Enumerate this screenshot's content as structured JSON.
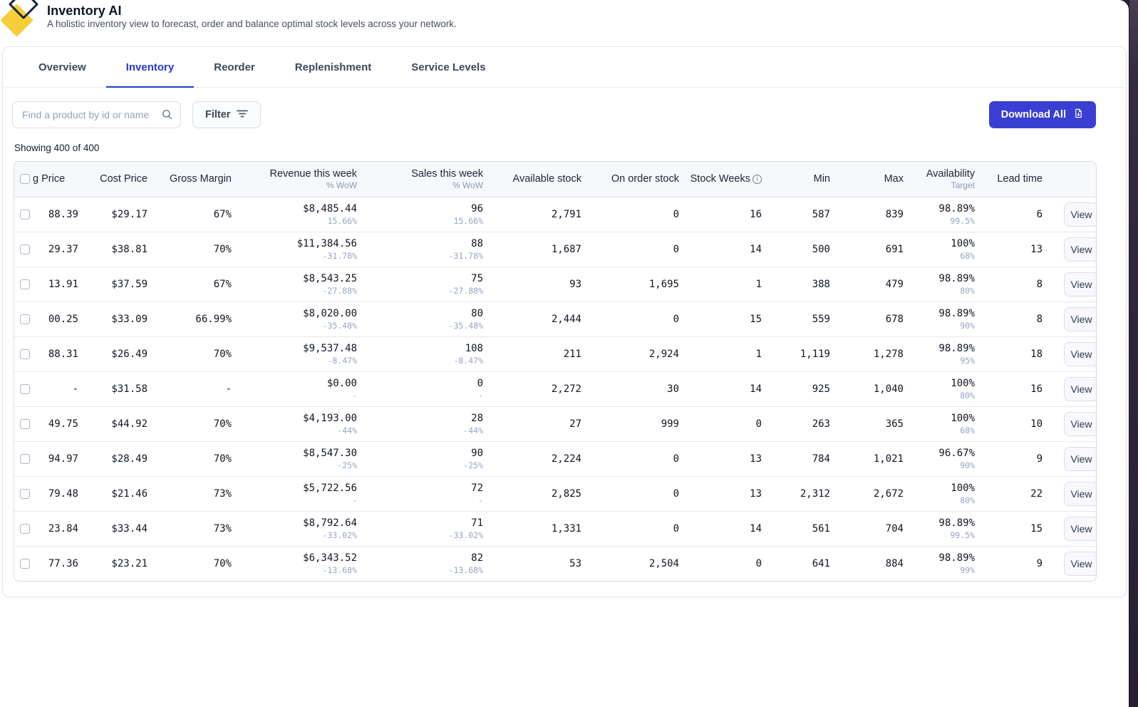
{
  "header": {
    "app_title": "Inventory AI",
    "subtitle": "A holistic inventory view to forecast, order and balance optimal stock levels across your network."
  },
  "tabs": [
    {
      "label": "Overview",
      "active": false
    },
    {
      "label": "Inventory",
      "active": true
    },
    {
      "label": "Reorder",
      "active": false
    },
    {
      "label": "Replenishment",
      "active": false
    },
    {
      "label": "Service Levels",
      "active": false
    }
  ],
  "toolbar": {
    "search_placeholder": "Find a product by id or name",
    "filter_label": "Filter",
    "download_label": "Download All"
  },
  "results_summary": "Showing 400 of 400",
  "colors": {
    "accent_blue": "#2438cf",
    "download_button_blue": "#3a3fd3",
    "brand_yellow": "#f6ce3b",
    "brand_navy": "#1b2438",
    "muted_value_text": "#97a4c2"
  },
  "table": {
    "view_label": "View",
    "columns": [
      {
        "key": "selling_price",
        "label": "g Price"
      },
      {
        "key": "cost_price",
        "label": "Cost Price"
      },
      {
        "key": "gross_margin",
        "label": "Gross Margin"
      },
      {
        "key": "revenue",
        "label": "Revenue this week",
        "sub": "% WoW"
      },
      {
        "key": "sales",
        "label": "Sales this week",
        "sub": "% WoW"
      },
      {
        "key": "available",
        "label": "Available stock"
      },
      {
        "key": "on_order",
        "label": "On order stock"
      },
      {
        "key": "stock_weeks",
        "label": "Stock Weeks",
        "info": true
      },
      {
        "key": "min",
        "label": "Min"
      },
      {
        "key": "max",
        "label": "Max"
      },
      {
        "key": "availability",
        "label": "Availability",
        "sub": "Target"
      },
      {
        "key": "lead_time",
        "label": "Lead time"
      },
      {
        "key": "view",
        "label": ""
      }
    ],
    "rows": [
      {
        "selling_price": "88.39",
        "cost_price": "$29.17",
        "gross_margin": "67%",
        "revenue": "$8,485.44",
        "revenue_wow": "15.66%",
        "sales": "96",
        "sales_wow": "15.66%",
        "available": "2,791",
        "on_order": "0",
        "stock_weeks": "16",
        "min": "587",
        "max": "839",
        "availability": "98.89%",
        "availability_target": "99.5%",
        "lead_time": "6"
      },
      {
        "selling_price": "29.37",
        "cost_price": "$38.81",
        "gross_margin": "70%",
        "revenue": "$11,384.56",
        "revenue_wow": "-31.78%",
        "sales": "88",
        "sales_wow": "-31.78%",
        "available": "1,687",
        "on_order": "0",
        "stock_weeks": "14",
        "min": "500",
        "max": "691",
        "availability": "100%",
        "availability_target": "68%",
        "lead_time": "13"
      },
      {
        "selling_price": "13.91",
        "cost_price": "$37.59",
        "gross_margin": "67%",
        "revenue": "$8,543.25",
        "revenue_wow": "-27.88%",
        "sales": "75",
        "sales_wow": "-27.88%",
        "available": "93",
        "on_order": "1,695",
        "stock_weeks": "1",
        "min": "388",
        "max": "479",
        "availability": "98.89%",
        "availability_target": "80%",
        "lead_time": "8"
      },
      {
        "selling_price": "00.25",
        "cost_price": "$33.09",
        "gross_margin": "66.99%",
        "revenue": "$8,020.00",
        "revenue_wow": "-35.48%",
        "sales": "80",
        "sales_wow": "-35.48%",
        "available": "2,444",
        "on_order": "0",
        "stock_weeks": "15",
        "min": "559",
        "max": "678",
        "availability": "98.89%",
        "availability_target": "90%",
        "lead_time": "8"
      },
      {
        "selling_price": "88.31",
        "cost_price": "$26.49",
        "gross_margin": "70%",
        "revenue": "$9,537.48",
        "revenue_wow": "-8.47%",
        "sales": "108",
        "sales_wow": "-8.47%",
        "available": "211",
        "on_order": "2,924",
        "stock_weeks": "1",
        "min": "1,119",
        "max": "1,278",
        "availability": "98.89%",
        "availability_target": "95%",
        "lead_time": "18"
      },
      {
        "selling_price": "-",
        "cost_price": "$31.58",
        "gross_margin": "-",
        "revenue": "$0.00",
        "revenue_wow": "-",
        "sales": "0",
        "sales_wow": "-",
        "available": "2,272",
        "on_order": "30",
        "stock_weeks": "14",
        "min": "925",
        "max": "1,040",
        "availability": "100%",
        "availability_target": "80%",
        "lead_time": "16"
      },
      {
        "selling_price": "49.75",
        "cost_price": "$44.92",
        "gross_margin": "70%",
        "revenue": "$4,193.00",
        "revenue_wow": "-44%",
        "sales": "28",
        "sales_wow": "-44%",
        "available": "27",
        "on_order": "999",
        "stock_weeks": "0",
        "min": "263",
        "max": "365",
        "availability": "100%",
        "availability_target": "68%",
        "lead_time": "10"
      },
      {
        "selling_price": "94.97",
        "cost_price": "$28.49",
        "gross_margin": "70%",
        "revenue": "$8,547.30",
        "revenue_wow": "-25%",
        "sales": "90",
        "sales_wow": "-25%",
        "available": "2,224",
        "on_order": "0",
        "stock_weeks": "13",
        "min": "784",
        "max": "1,021",
        "availability": "96.67%",
        "availability_target": "90%",
        "lead_time": "9"
      },
      {
        "selling_price": "79.48",
        "cost_price": "$21.46",
        "gross_margin": "73%",
        "revenue": "$5,722.56",
        "revenue_wow": "-",
        "sales": "72",
        "sales_wow": "-",
        "available": "2,825",
        "on_order": "0",
        "stock_weeks": "13",
        "min": "2,312",
        "max": "2,672",
        "availability": "100%",
        "availability_target": "80%",
        "lead_time": "22"
      },
      {
        "selling_price": "23.84",
        "cost_price": "$33.44",
        "gross_margin": "73%",
        "revenue": "$8,792.64",
        "revenue_wow": "-33.02%",
        "sales": "71",
        "sales_wow": "-33.02%",
        "available": "1,331",
        "on_order": "0",
        "stock_weeks": "14",
        "min": "561",
        "max": "704",
        "availability": "98.89%",
        "availability_target": "99.5%",
        "lead_time": "15"
      },
      {
        "selling_price": "77.36",
        "cost_price": "$23.21",
        "gross_margin": "70%",
        "revenue": "$6,343.52",
        "revenue_wow": "-13.68%",
        "sales": "82",
        "sales_wow": "-13.68%",
        "available": "53",
        "on_order": "2,504",
        "stock_weeks": "0",
        "min": "641",
        "max": "884",
        "availability": "98.89%",
        "availability_target": "99%",
        "lead_time": "9"
      }
    ]
  }
}
